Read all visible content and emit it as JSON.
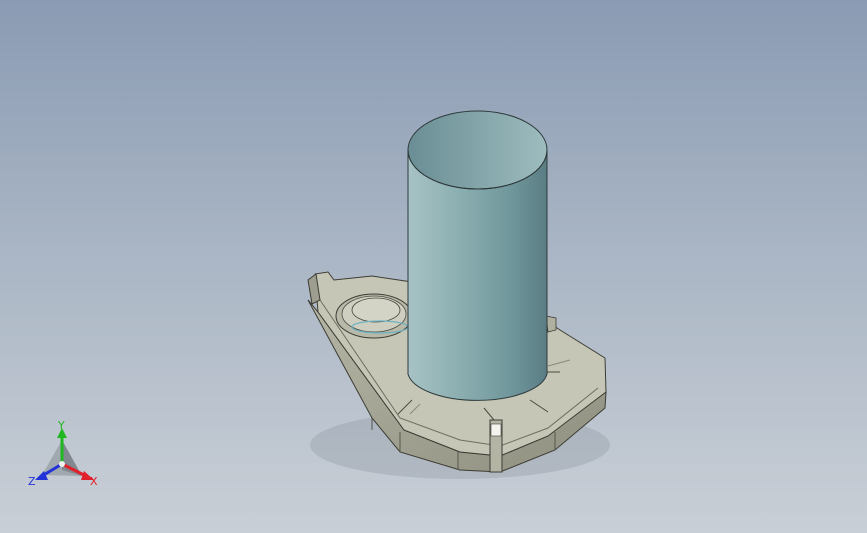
{
  "triad": {
    "x_label": "X",
    "y_label": "Y",
    "z_label": "Z",
    "x_color": "#e0202a",
    "y_color": "#20b820",
    "z_color": "#2032d8"
  },
  "model": {
    "cylinder_color": "#6f9aa0",
    "housing_color": "#a8a898"
  }
}
